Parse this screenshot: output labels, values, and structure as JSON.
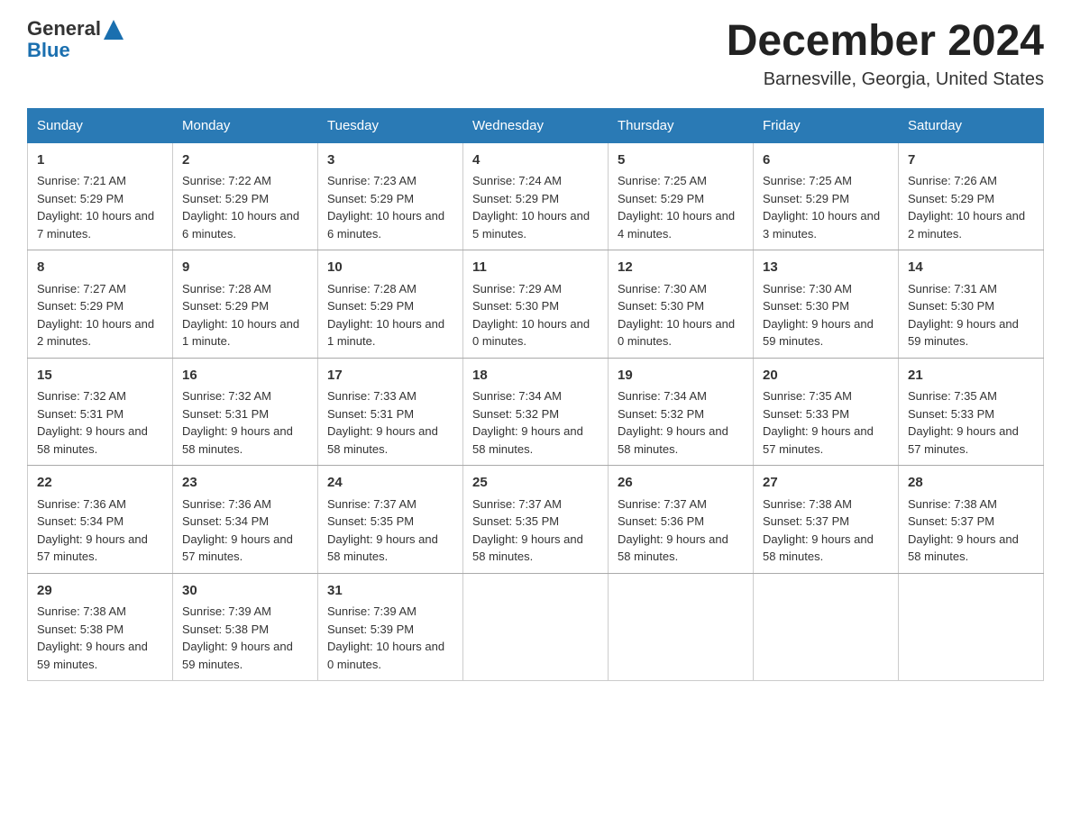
{
  "header": {
    "logo_general": "General",
    "logo_blue": "Blue",
    "month_title": "December 2024",
    "location": "Barnesville, Georgia, United States"
  },
  "days_of_week": [
    "Sunday",
    "Monday",
    "Tuesday",
    "Wednesday",
    "Thursday",
    "Friday",
    "Saturday"
  ],
  "weeks": [
    [
      {
        "day": "1",
        "sunrise": "7:21 AM",
        "sunset": "5:29 PM",
        "daylight": "10 hours and 7 minutes."
      },
      {
        "day": "2",
        "sunrise": "7:22 AM",
        "sunset": "5:29 PM",
        "daylight": "10 hours and 6 minutes."
      },
      {
        "day": "3",
        "sunrise": "7:23 AM",
        "sunset": "5:29 PM",
        "daylight": "10 hours and 6 minutes."
      },
      {
        "day": "4",
        "sunrise": "7:24 AM",
        "sunset": "5:29 PM",
        "daylight": "10 hours and 5 minutes."
      },
      {
        "day": "5",
        "sunrise": "7:25 AM",
        "sunset": "5:29 PM",
        "daylight": "10 hours and 4 minutes."
      },
      {
        "day": "6",
        "sunrise": "7:25 AM",
        "sunset": "5:29 PM",
        "daylight": "10 hours and 3 minutes."
      },
      {
        "day": "7",
        "sunrise": "7:26 AM",
        "sunset": "5:29 PM",
        "daylight": "10 hours and 2 minutes."
      }
    ],
    [
      {
        "day": "8",
        "sunrise": "7:27 AM",
        "sunset": "5:29 PM",
        "daylight": "10 hours and 2 minutes."
      },
      {
        "day": "9",
        "sunrise": "7:28 AM",
        "sunset": "5:29 PM",
        "daylight": "10 hours and 1 minute."
      },
      {
        "day": "10",
        "sunrise": "7:28 AM",
        "sunset": "5:29 PM",
        "daylight": "10 hours and 1 minute."
      },
      {
        "day": "11",
        "sunrise": "7:29 AM",
        "sunset": "5:30 PM",
        "daylight": "10 hours and 0 minutes."
      },
      {
        "day": "12",
        "sunrise": "7:30 AM",
        "sunset": "5:30 PM",
        "daylight": "10 hours and 0 minutes."
      },
      {
        "day": "13",
        "sunrise": "7:30 AM",
        "sunset": "5:30 PM",
        "daylight": "9 hours and 59 minutes."
      },
      {
        "day": "14",
        "sunrise": "7:31 AM",
        "sunset": "5:30 PM",
        "daylight": "9 hours and 59 minutes."
      }
    ],
    [
      {
        "day": "15",
        "sunrise": "7:32 AM",
        "sunset": "5:31 PM",
        "daylight": "9 hours and 58 minutes."
      },
      {
        "day": "16",
        "sunrise": "7:32 AM",
        "sunset": "5:31 PM",
        "daylight": "9 hours and 58 minutes."
      },
      {
        "day": "17",
        "sunrise": "7:33 AM",
        "sunset": "5:31 PM",
        "daylight": "9 hours and 58 minutes."
      },
      {
        "day": "18",
        "sunrise": "7:34 AM",
        "sunset": "5:32 PM",
        "daylight": "9 hours and 58 minutes."
      },
      {
        "day": "19",
        "sunrise": "7:34 AM",
        "sunset": "5:32 PM",
        "daylight": "9 hours and 58 minutes."
      },
      {
        "day": "20",
        "sunrise": "7:35 AM",
        "sunset": "5:33 PM",
        "daylight": "9 hours and 57 minutes."
      },
      {
        "day": "21",
        "sunrise": "7:35 AM",
        "sunset": "5:33 PM",
        "daylight": "9 hours and 57 minutes."
      }
    ],
    [
      {
        "day": "22",
        "sunrise": "7:36 AM",
        "sunset": "5:34 PM",
        "daylight": "9 hours and 57 minutes."
      },
      {
        "day": "23",
        "sunrise": "7:36 AM",
        "sunset": "5:34 PM",
        "daylight": "9 hours and 57 minutes."
      },
      {
        "day": "24",
        "sunrise": "7:37 AM",
        "sunset": "5:35 PM",
        "daylight": "9 hours and 58 minutes."
      },
      {
        "day": "25",
        "sunrise": "7:37 AM",
        "sunset": "5:35 PM",
        "daylight": "9 hours and 58 minutes."
      },
      {
        "day": "26",
        "sunrise": "7:37 AM",
        "sunset": "5:36 PM",
        "daylight": "9 hours and 58 minutes."
      },
      {
        "day": "27",
        "sunrise": "7:38 AM",
        "sunset": "5:37 PM",
        "daylight": "9 hours and 58 minutes."
      },
      {
        "day": "28",
        "sunrise": "7:38 AM",
        "sunset": "5:37 PM",
        "daylight": "9 hours and 58 minutes."
      }
    ],
    [
      {
        "day": "29",
        "sunrise": "7:38 AM",
        "sunset": "5:38 PM",
        "daylight": "9 hours and 59 minutes."
      },
      {
        "day": "30",
        "sunrise": "7:39 AM",
        "sunset": "5:38 PM",
        "daylight": "9 hours and 59 minutes."
      },
      {
        "day": "31",
        "sunrise": "7:39 AM",
        "sunset": "5:39 PM",
        "daylight": "10 hours and 0 minutes."
      },
      null,
      null,
      null,
      null
    ]
  ]
}
